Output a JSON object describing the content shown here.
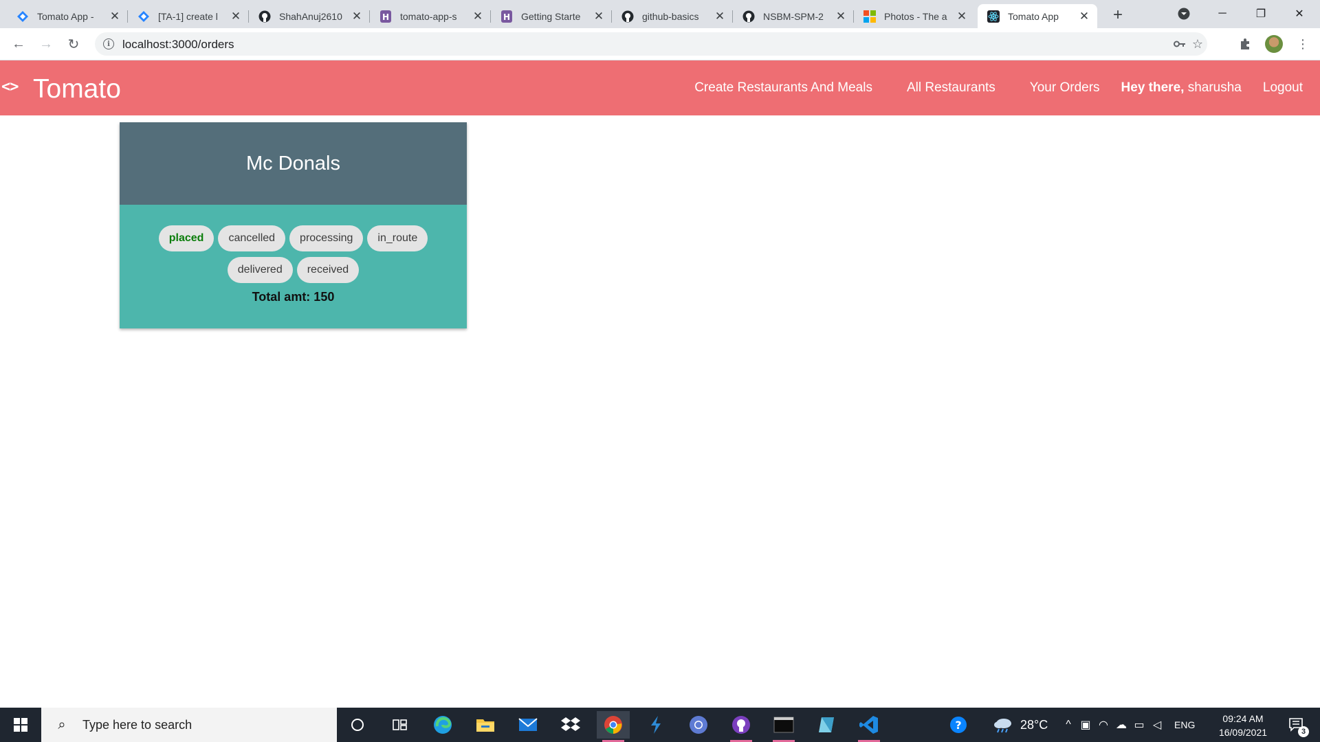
{
  "browser": {
    "tabs": [
      {
        "title": "Tomato App -",
        "icon": "jira-icon",
        "active": false
      },
      {
        "title": "[TA-1] create l",
        "icon": "jira-icon",
        "active": false
      },
      {
        "title": "ShahAnuj2610",
        "icon": "github-icon",
        "active": false
      },
      {
        "title": "tomato-app-s",
        "icon": "heroku-icon",
        "active": false
      },
      {
        "title": "Getting Starte",
        "icon": "heroku-icon",
        "active": false
      },
      {
        "title": "github-basics",
        "icon": "github-icon",
        "active": false
      },
      {
        "title": "NSBM-SPM-2",
        "icon": "github-icon",
        "active": false
      },
      {
        "title": "Photos - The a",
        "icon": "microsoft-icon",
        "active": false
      },
      {
        "title": "Tomato App",
        "icon": "react-icon",
        "active": true
      }
    ],
    "url": "localhost:3000/orders"
  },
  "app": {
    "brand_icon": "<>",
    "brand": "Tomato",
    "nav": {
      "create": "Create Restaurants And Meals",
      "all_restaurants": "All Restaurants",
      "orders": "Your Orders",
      "greeting_bold": "Hey there,",
      "username": "sharusha",
      "logout": "Logout"
    },
    "colors": {
      "navbar": "#ee6e73",
      "card_header": "#546e7a",
      "card_body": "#4db6ac",
      "active_status": "#0b7d0b"
    }
  },
  "order": {
    "restaurant": "Mc Donals",
    "statuses": [
      "placed",
      "cancelled",
      "processing",
      "in_route",
      "delivered",
      "received"
    ],
    "active_status": "placed",
    "total": "Total amt: 150"
  },
  "taskbar": {
    "search_placeholder": "Type here to search",
    "weather": "28°C",
    "language": "ENG",
    "time": "09:24 AM",
    "date": "16/09/2021",
    "notifications": "3"
  }
}
